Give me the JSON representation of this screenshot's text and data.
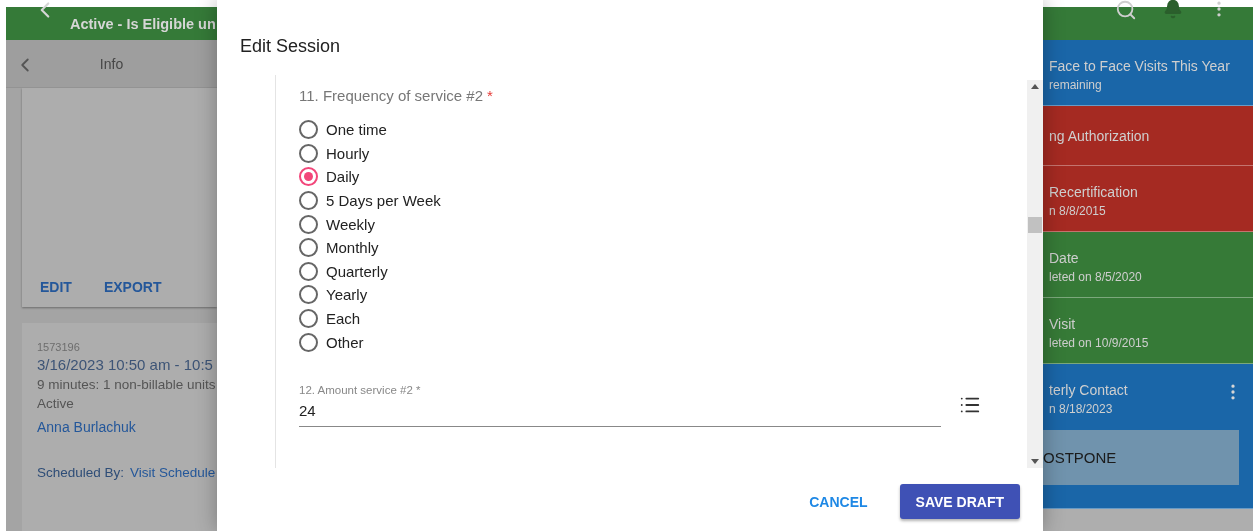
{
  "app_bar": {
    "title": "Active - Is Eligible un"
  },
  "info_panel": {
    "title": "Info",
    "actions": [
      "EDIT",
      "EXPORT"
    ],
    "session_card": {
      "id": "1573196",
      "time": "3/16/2023 10:50 am - 10:5",
      "duration": "9 minutes: 1 non-billable units",
      "status": "Active",
      "person": "Anna Burlachuk",
      "scheduled_by_label": "Scheduled By:",
      "scheduled_by": "Visit Schedule"
    }
  },
  "tasks": [
    {
      "title": "Face to Face Visits This Year",
      "subtitle": "remaining",
      "color": "#1a66a8"
    },
    {
      "title": "ng Authorization",
      "color": "#a52a22"
    },
    {
      "title": "Recertification",
      "subtitle": "n 8/8/2015",
      "color": "#a52a22"
    },
    {
      "title": "Date",
      "subtitle": "leted on 8/5/2020",
      "color": "#367a37"
    },
    {
      "title": "Visit",
      "subtitle": "leted on 10/9/2015",
      "color": "#367a37"
    },
    {
      "title": "terly Contact",
      "subtitle": "n 8/18/2023",
      "color": "#1a66a8",
      "menu": true,
      "action": "OSTPONE"
    }
  ],
  "dialog": {
    "title": "Edit Session",
    "question": {
      "label": "11. Frequency of service #2",
      "required_mark": "*",
      "options": [
        {
          "label": "One time",
          "selected": false
        },
        {
          "label": "Hourly",
          "selected": false
        },
        {
          "label": "Daily",
          "selected": true
        },
        {
          "label": "5 Days per Week",
          "selected": false
        },
        {
          "label": "Weekly",
          "selected": false
        },
        {
          "label": "Monthly",
          "selected": false
        },
        {
          "label": "Quarterly",
          "selected": false
        },
        {
          "label": "Yearly",
          "selected": false
        },
        {
          "label": "Each",
          "selected": false
        },
        {
          "label": "Other",
          "selected": false
        }
      ]
    },
    "amount_field": {
      "label": "12. Amount service #2 *",
      "value": "24"
    },
    "buttons": [
      {
        "label": "CANCEL",
        "kind": "text"
      },
      {
        "label": "SAVE DRAFT",
        "kind": "primary"
      }
    ]
  }
}
